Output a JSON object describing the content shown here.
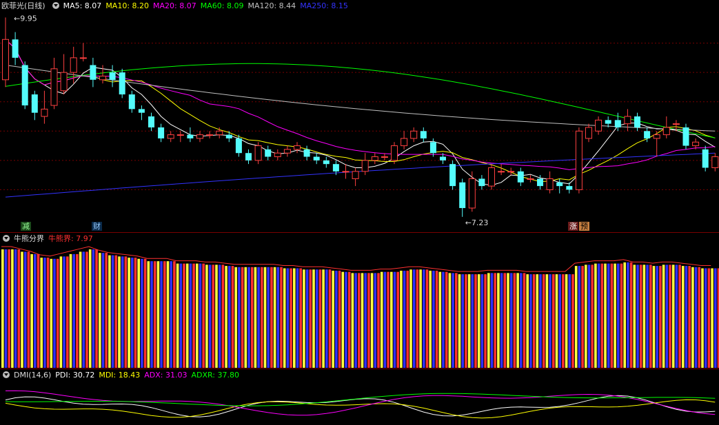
{
  "header": {
    "stock_name": "欧菲光(日线)",
    "ma": [
      {
        "label": "MA5: 8.07",
        "color": "#ffffff"
      },
      {
        "label": "MA10: 8.20",
        "color": "#ffff00"
      },
      {
        "label": "MA20: 8.07",
        "color": "#ff00ff"
      },
      {
        "label": "MA60: 8.09",
        "color": "#00ff00"
      },
      {
        "label": "MA120: 8.44",
        "color": "#c0c0c0"
      },
      {
        "label": "MA250: 8.15",
        "color": "#3333ff"
      }
    ]
  },
  "annotations": {
    "high_label": "9.95",
    "low_label": "7.23",
    "badge_1": "减",
    "badge_2": "财",
    "badge_3": "涨",
    "badge_4": "预"
  },
  "indicator1": {
    "title": "牛熊分界",
    "value_label": "牛熊界: 7.97",
    "value_color": "#ff3030"
  },
  "indicator2": {
    "title": "DMI(14,6)",
    "pdi": "PDI: 30.72",
    "mdi": "MDI: 18.43",
    "adx": "ADX: 31.03",
    "adxr": "ADXR: 37.80"
  },
  "colors": {
    "up": "#ff4040",
    "down": "#54fcfc",
    "bar_yellow": "#ffff40",
    "bar_red": "#ff3030",
    "bar_blue": "#3030ff"
  },
  "chart_data": {
    "type": "candlestick",
    "price_range": [
      7.2,
      10.0
    ],
    "candles": [
      [
        9.1,
        9.65,
        9.95,
        9.0
      ],
      [
        9.65,
        9.4,
        9.75,
        9.3
      ],
      [
        9.3,
        8.75,
        9.35,
        8.7
      ],
      [
        8.9,
        8.65,
        8.95,
        8.55
      ],
      [
        8.6,
        8.7,
        8.95,
        8.5
      ],
      [
        8.75,
        9.25,
        9.4,
        8.7
      ],
      [
        8.95,
        9.2,
        9.45,
        8.9
      ],
      [
        9.2,
        9.4,
        9.55,
        9.05
      ],
      [
        9.4,
        9.4,
        9.6,
        9.35
      ],
      [
        9.3,
        9.1,
        9.4,
        9.0
      ],
      [
        9.1,
        9.15,
        9.3,
        9.05
      ],
      [
        9.2,
        9.1,
        9.3,
        9.0
      ],
      [
        9.2,
        8.9,
        9.25,
        8.85
      ],
      [
        8.9,
        8.7,
        8.95,
        8.65
      ],
      [
        8.7,
        8.65,
        8.75,
        8.55
      ],
      [
        8.6,
        8.45,
        8.65,
        8.4
      ],
      [
        8.45,
        8.3,
        8.5,
        8.25
      ],
      [
        8.3,
        8.35,
        8.4,
        8.25
      ],
      [
        8.35,
        8.35,
        8.4,
        8.25
      ],
      [
        8.35,
        8.3,
        8.45,
        8.25
      ],
      [
        8.3,
        8.35,
        8.4,
        8.25
      ],
      [
        8.35,
        8.35,
        8.4,
        8.3
      ],
      [
        8.35,
        8.4,
        8.45,
        8.3
      ],
      [
        8.35,
        8.3,
        8.4,
        8.25
      ],
      [
        8.3,
        8.1,
        8.35,
        8.05
      ],
      [
        8.1,
        8.0,
        8.15,
        7.95
      ],
      [
        8.0,
        8.2,
        8.25,
        7.95
      ],
      [
        8.15,
        8.05,
        8.2,
        8.0
      ],
      [
        8.05,
        8.1,
        8.15,
        8.0
      ],
      [
        8.1,
        8.15,
        8.2,
        8.05
      ],
      [
        8.15,
        8.2,
        8.25,
        8.1
      ],
      [
        8.15,
        8.05,
        8.2,
        8.0
      ],
      [
        8.05,
        8.0,
        8.1,
        7.95
      ],
      [
        8.0,
        7.95,
        8.05,
        7.9
      ],
      [
        7.95,
        7.85,
        8.0,
        7.8
      ],
      [
        7.85,
        7.85,
        7.95,
        7.75
      ],
      [
        7.75,
        7.85,
        7.9,
        7.65
      ],
      [
        7.85,
        8.0,
        8.1,
        7.8
      ],
      [
        8.0,
        8.05,
        8.1,
        7.95
      ],
      [
        8.05,
        8.05,
        8.1,
        8.0
      ],
      [
        8.0,
        8.2,
        8.25,
        7.95
      ],
      [
        8.2,
        8.3,
        8.4,
        8.15
      ],
      [
        8.3,
        8.4,
        8.45,
        8.25
      ],
      [
        8.4,
        8.3,
        8.45,
        8.25
      ],
      [
        8.25,
        8.1,
        8.3,
        8.05
      ],
      [
        8.05,
        8.0,
        8.1,
        7.95
      ],
      [
        7.95,
        7.65,
        8.0,
        7.6
      ],
      [
        7.7,
        7.35,
        7.75,
        7.23
      ],
      [
        7.35,
        7.75,
        7.85,
        7.3
      ],
      [
        7.75,
        7.65,
        7.8,
        7.6
      ],
      [
        7.65,
        7.9,
        7.95,
        7.6
      ],
      [
        7.85,
        7.85,
        7.95,
        7.8
      ],
      [
        7.85,
        7.85,
        7.9,
        7.8
      ],
      [
        7.85,
        7.7,
        7.9,
        7.65
      ],
      [
        7.75,
        7.75,
        7.8,
        7.7
      ],
      [
        7.75,
        7.65,
        7.8,
        7.6
      ],
      [
        7.6,
        7.75,
        7.85,
        7.55
      ],
      [
        7.7,
        7.65,
        7.75,
        7.55
      ],
      [
        7.65,
        7.6,
        7.7,
        7.55
      ],
      [
        7.6,
        8.4,
        8.45,
        7.55
      ],
      [
        8.3,
        8.45,
        8.5,
        8.25
      ],
      [
        8.4,
        8.55,
        8.6,
        8.35
      ],
      [
        8.55,
        8.5,
        8.6,
        8.45
      ],
      [
        8.55,
        8.45,
        8.65,
        8.4
      ],
      [
        8.5,
        8.6,
        8.7,
        8.4
      ],
      [
        8.6,
        8.45,
        8.65,
        8.4
      ],
      [
        8.4,
        8.3,
        8.45,
        8.25
      ],
      [
        8.3,
        8.35,
        8.4,
        8.05
      ],
      [
        8.35,
        8.45,
        8.6,
        8.3
      ],
      [
        8.5,
        8.5,
        8.55,
        8.4
      ],
      [
        8.45,
        8.2,
        8.5,
        8.15
      ],
      [
        8.2,
        8.25,
        8.3,
        8.15
      ],
      [
        8.15,
        7.9,
        8.2,
        7.85
      ],
      [
        7.9,
        8.05,
        8.1,
        7.85
      ]
    ],
    "bulls_bears_bars": [
      1.0,
      1.0,
      0.98,
      0.96,
      0.93,
      0.92,
      0.94,
      0.96,
      0.98,
      1.0,
      0.97,
      0.95,
      0.94,
      0.93,
      0.92,
      0.9,
      0.9,
      0.9,
      0.88,
      0.88,
      0.88,
      0.87,
      0.87,
      0.86,
      0.85,
      0.85,
      0.85,
      0.85,
      0.85,
      0.84,
      0.84,
      0.83,
      0.83,
      0.83,
      0.82,
      0.81,
      0.8,
      0.8,
      0.8,
      0.81,
      0.81,
      0.82,
      0.83,
      0.83,
      0.82,
      0.81,
      0.8,
      0.79,
      0.79,
      0.79,
      0.8,
      0.8,
      0.8,
      0.8,
      0.79,
      0.79,
      0.79,
      0.79,
      0.79,
      0.86,
      0.87,
      0.88,
      0.88,
      0.88,
      0.89,
      0.87,
      0.87,
      0.86,
      0.87,
      0.87,
      0.86,
      0.85,
      0.84,
      0.84
    ]
  }
}
